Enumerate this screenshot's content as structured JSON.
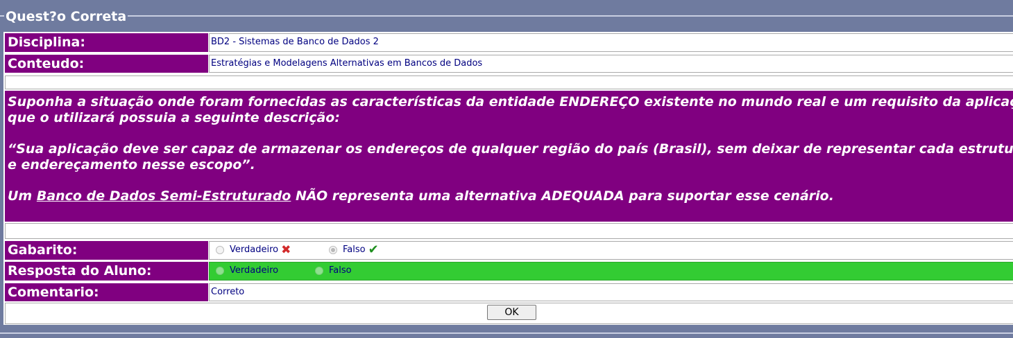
{
  "fieldset": {
    "legend": "Quest?o Correta"
  },
  "disciplina": {
    "label": "Disciplina:",
    "value": "BD2 - Sistemas de Banco de Dados 2"
  },
  "conteudo": {
    "label": "Conteudo:",
    "value": "Estratégias e Modelagens Alternativas em Bancos de Dados"
  },
  "question": {
    "line1": "Suponha a situação onde foram fornecidas as características da entidade ENDEREÇO existente no mundo real e um requisito da aplicação",
    "line2": "que o utilizará possuia a seguinte descrição:",
    "line3": "“Sua aplicação deve ser capaz de armazenar os endereços de qualquer região do país (Brasil), sem deixar de representar cada estrutura",
    "line4": "e endereçamento nesse escopo”.",
    "line5_pre": "Um ",
    "line5_link": "Banco de Dados Semi-Estruturado",
    "line5_post": " NÃO representa uma alternativa ADEQUADA para suportar esse cenário."
  },
  "gabarito": {
    "label": "Gabarito:",
    "option_true": "Verdadeiro",
    "option_false": "Falso",
    "selected": "Falso",
    "true_icon": "x-mark-icon",
    "false_icon": "check-mark-icon"
  },
  "resposta": {
    "label": "Resposta do Aluno:",
    "option_true": "Verdadeiro",
    "option_false": "Falso",
    "highlight_color": "#33cc33"
  },
  "comentario": {
    "label": "Comentario:",
    "value": "Correto"
  },
  "ok_button": "OK",
  "colors": {
    "background": "#6f7b9f",
    "label_bg": "#800080",
    "value_text": "#000080"
  }
}
